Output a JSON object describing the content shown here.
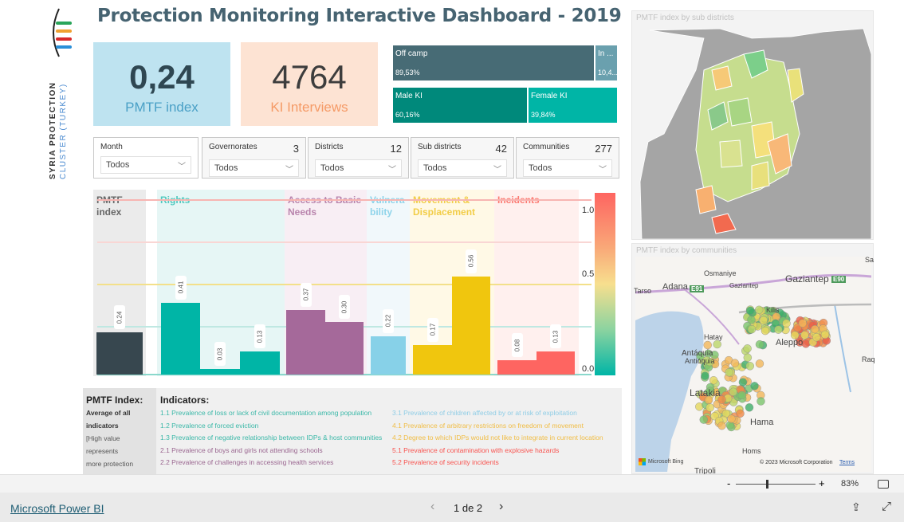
{
  "logo": {
    "line1": "SYRIA PROTECTION",
    "line2": "CLUSTER (TURKEY)"
  },
  "title": "Protection Monitoring Interactive Dashboard - 2019",
  "kpis": [
    {
      "value": "0,24",
      "label": "PMTF index",
      "bg": "#bee3f0",
      "vcolor": "#2f4752",
      "lcolor": "#4aa0c6"
    },
    {
      "value": "4764",
      "label": "KI Interviews",
      "bg": "#fde3d3",
      "vcolor": "#3d3d3d",
      "lcolor": "#f59a66"
    }
  ],
  "treemap": {
    "camp": [
      {
        "label": "Off camp",
        "pct": "89,53%",
        "color": "#476b75"
      },
      {
        "label": "In ...",
        "pct": "10,4...",
        "color": "#6aa0ae"
      }
    ],
    "gender": [
      {
        "label": "Male KI",
        "pct": "60,16%",
        "color": "#00897b"
      },
      {
        "label": "Female KI",
        "pct": "39,84%",
        "color": "#00b5a6"
      }
    ]
  },
  "slicers": [
    {
      "label": "Month",
      "count": "",
      "value": "Todos"
    },
    {
      "label": "Governorates",
      "count": "3",
      "value": "Todos"
    },
    {
      "label": "Districts",
      "count": "12",
      "value": "Todos"
    },
    {
      "label": "Sub districts",
      "count": "42",
      "value": "Todos"
    },
    {
      "label": "Communities",
      "count": "277",
      "value": "Todos"
    }
  ],
  "chart_data": {
    "type": "bar",
    "ylim": [
      0,
      1
    ],
    "gradient_ticks": [
      "1.0",
      "0.5",
      "0.0"
    ],
    "groups": [
      {
        "title": "PMTF index",
        "color": "#37474f",
        "title_color": "#666666",
        "bg": "#ebebeb",
        "values": [
          0.24
        ],
        "labels": [
          "0.24"
        ]
      },
      {
        "title": "Rights",
        "color": "#00b5a6",
        "title_color": "#4fc9bf",
        "bg": "#e6f6f5",
        "values": [
          0.41,
          0.03,
          0.13
        ],
        "labels": [
          "0.41",
          "0.03",
          "0.13"
        ]
      },
      {
        "title": "Access to Basic Needs",
        "color": "#a5699a",
        "title_color": "#b984ad",
        "bg": "#f8eef4",
        "values": [
          0.37,
          0.3
        ],
        "labels": [
          "0.37",
          "0.30"
        ]
      },
      {
        "title": "Vulnera bility",
        "color": "#87d1e8",
        "title_color": "#8fd4ea",
        "bg": "#f1f8fb",
        "values": [
          0.22
        ],
        "labels": [
          "0.22"
        ]
      },
      {
        "title": "Movement & Displacement",
        "color": "#f0c60e",
        "title_color": "#f2cd47",
        "bg": "#fff9e6",
        "values": [
          0.17,
          0.56
        ],
        "labels": [
          "0.17",
          "0.56"
        ]
      },
      {
        "title": "Incidents",
        "color": "#fe6561",
        "title_color": "#fc7a72",
        "bg": "#fff0ee",
        "values": [
          0.08,
          0.13
        ],
        "labels": [
          "0.08",
          "0.13"
        ]
      }
    ]
  },
  "legend": {
    "pmtf_title": "PMTF Index:",
    "pmtf_desc": [
      "Average of all",
      "indicators"
    ],
    "pmtf_note": [
      "[High value represents",
      "more protection",
      "threats]"
    ],
    "ind_title": "Indicators:",
    "col1": [
      {
        "t": "1.1 Prevalence of loss or lack of civil documentation among population",
        "c": "#3bb8a8"
      },
      {
        "t": "1.2 Prevalence of forced eviction",
        "c": "#3bb8a8"
      },
      {
        "t": "1.3 Prevalence of negative relationship between IDPs & host communities",
        "c": "#3bb8a8"
      },
      {
        "t": "2.1 Prevalence of boys and girls not attending schools",
        "c": "#9a6690"
      },
      {
        "t": "2.2 Prevalence of challenges in accessing health services",
        "c": "#9a6690"
      }
    ],
    "col2": [
      {
        "t": "3.1 Prevalence of children affected by or at risk of exploitation",
        "c": "#8fcde6"
      },
      {
        "t": "4.1 Prevalence of arbitrary restrictions on freedom of movement",
        "c": "#f1bd45"
      },
      {
        "t": "4.2 Degree to which IDPs would not like to integrate  in current location",
        "c": "#f1bd45"
      },
      {
        "t": "5.1 Prevalence of contamination with explosive hazards",
        "c": "#f8524e"
      },
      {
        "t": "5.2 Prevalence of security incidents",
        "c": "#f8524e"
      }
    ]
  },
  "map1": {
    "title": "PMTF index by sub districts"
  },
  "map2": {
    "title": "PMTF index by communities",
    "places": [
      "Adana",
      "Tarso",
      "Osmaniye",
      "Gaziantep",
      "Gaziantep",
      "Kilis",
      "Hatay",
      "Antáquia",
      "Antióquia",
      "Aleppo",
      "Latakia",
      "Hama",
      "Homs",
      "Tripoli",
      "Raq",
      "Sa"
    ],
    "roads": [
      "E91",
      "E90"
    ],
    "bing": "Microsoft Bing",
    "copyright": "© 2023 Microsoft Corporation",
    "terms": "Terms"
  },
  "zoombar": {
    "minus": "-",
    "plus": "+",
    "zoom": "83%",
    "zoom_level": 83
  },
  "footer": {
    "brand": "Microsoft Power BI",
    "page": "1 de 2"
  }
}
